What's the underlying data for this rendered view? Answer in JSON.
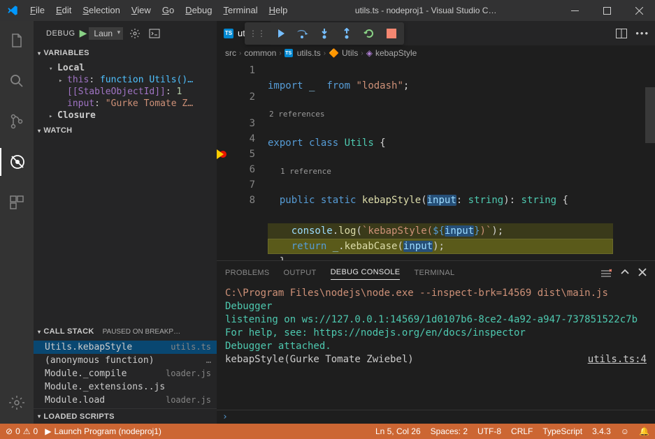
{
  "window": {
    "title": "utils.ts - nodeproj1 - Visual Studio C…"
  },
  "menu": {
    "file": "File",
    "edit": "Edit",
    "selection": "Selection",
    "view": "View",
    "go": "Go",
    "debug": "Debug",
    "terminal": "Terminal",
    "help": "Help"
  },
  "sidebar": {
    "title": "DEBUG",
    "config": "Laun",
    "sections": {
      "variables": "VARIABLES",
      "watch": "WATCH",
      "callstack": "CALL STACK",
      "callstack_status": "PAUSED ON BREAKP…",
      "loadedscripts": "LOADED SCRIPTS"
    },
    "vars": {
      "local": "Local",
      "this_name": "this",
      "this_val": "function Utils()…",
      "stable_name": "[[StableObjectId]]",
      "stable_val": "1",
      "input_name": "input",
      "input_val": "\"Gurke Tomate Z…",
      "closure": "Closure"
    },
    "calls": [
      {
        "fn": "Utils.kebapStyle",
        "file": "utils.ts"
      },
      {
        "fn": "(anonymous function)",
        "file": "…"
      },
      {
        "fn": "Module._compile",
        "file": "loader.js"
      },
      {
        "fn": "Module._extensions..js",
        "file": ""
      },
      {
        "fn": "Module.load",
        "file": "loader.js"
      }
    ]
  },
  "tabs": {
    "active": "utils.ts"
  },
  "breadcrumbs": {
    "p0": "src",
    "p1": "common",
    "p2": "utils.ts",
    "p3": "Utils",
    "p4": "kebapStyle"
  },
  "code": {
    "lens1": "2 references",
    "lens2": "1 reference",
    "l1a": "import",
    "l1b": "_",
    "l1c": "from",
    "l1d": "\"lodash\"",
    "l1e": ";",
    "l2a": "export",
    "l2b": "class",
    "l2c": "Utils",
    "l2d": "{",
    "l3a": "public",
    "l3b": "static",
    "l3c": "kebapStyle",
    "l3d": "(",
    "l3e": "input",
    "l3f": ": ",
    "l3g": "string",
    "l3h": ")",
    "l3i": ": ",
    "l3j": "string",
    "l3k": " {",
    "l4a": "console",
    "l4b": ".",
    "l4c": "log",
    "l4d": "(",
    "l4e": "`kebapStyle(",
    "l4f": "${",
    "l4g": "input",
    "l4h": "}",
    "l4i": ")`",
    "l4j": ");",
    "l5a": "return",
    "l5b": "_",
    "l5c": ".",
    "l5d": "kebabCase",
    "l5e": "(",
    "l5f": "input",
    "l5g": ");",
    "l6": "}",
    "l7": "}",
    "lines": [
      "1",
      "2",
      "3",
      "4",
      "5",
      "6",
      "7",
      "8"
    ]
  },
  "panel": {
    "tabs": {
      "problems": "PROBLEMS",
      "output": "OUTPUT",
      "debug": "DEBUG CONSOLE",
      "terminal": "TERMINAL"
    },
    "c1": "C:\\Program Files\\nodejs\\node.exe --inspect-brk=14569 dist\\main.js",
    "c2a": "Debugger",
    "c2b": " listening on ws://127.0.0.1:14569/1d0107b6-8ce2-4a92-a947-737851522c7b",
    "c3": "For help, see: https://nodejs.org/en/docs/inspector",
    "c4": "Debugger attached.",
    "c5": "kebapStyle(Gurke Tomate Zwiebel)",
    "c5link": "utils.ts:4",
    "prompt": "›"
  },
  "status": {
    "err_icon": "⊘",
    "err": "0",
    "warn_icon": "⚠",
    "warn": "0",
    "launch": "Launch Program (nodeproj1)",
    "lncol": "Ln 5, Col 26",
    "spaces": "Spaces: 2",
    "enc": "UTF-8",
    "eol": "CRLF",
    "lang": "TypeScript",
    "ver": "3.4.3"
  }
}
